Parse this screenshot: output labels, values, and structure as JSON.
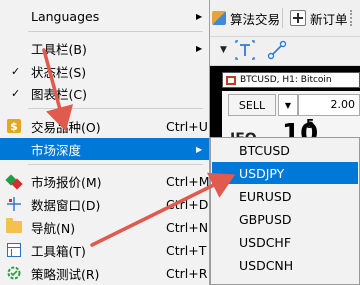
{
  "toolbar": {
    "algo_label": "算法交易",
    "new_order_label": "新订单"
  },
  "chart": {
    "title": "BTCUSD, H1: Bitcoin",
    "sell_label": "SELL",
    "lot_value": "2.00",
    "price_big": "10",
    "price_sup": "5",
    "price_partial": "IEO"
  },
  "menu": {
    "items": [
      {
        "label": "Languages",
        "shortcut": "",
        "has_submenu": true,
        "icon": "none"
      },
      {
        "label": "工具栏(B)",
        "shortcut": "",
        "has_submenu": true,
        "icon": "none"
      },
      {
        "label": "状态栏(S)",
        "shortcut": "",
        "has_submenu": false,
        "icon": "check-icon"
      },
      {
        "label": "图表栏(C)",
        "shortcut": "",
        "has_submenu": false,
        "icon": "check-icon"
      },
      {
        "label": "交易品种(O)",
        "shortcut": "Ctrl+U",
        "has_submenu": false,
        "icon": "dollar-icon"
      },
      {
        "label": "市场深度",
        "shortcut": "",
        "has_submenu": true,
        "icon": "none",
        "highlighted": true
      },
      {
        "label": "市场报价(M)",
        "shortcut": "Ctrl+M",
        "has_submenu": false,
        "icon": "market-watch-icon"
      },
      {
        "label": "数据窗口(D)",
        "shortcut": "Ctrl+D",
        "has_submenu": false,
        "icon": "crosshair-icon"
      },
      {
        "label": "导航(N)",
        "shortcut": "Ctrl+N",
        "has_submenu": false,
        "icon": "folder-icon"
      },
      {
        "label": "工具箱(T)",
        "shortcut": "Ctrl+T",
        "has_submenu": false,
        "icon": "toolbox-icon"
      },
      {
        "label": "策略测试(R)",
        "shortcut": "Ctrl+R",
        "has_submenu": false,
        "icon": "strategy-tester-icon"
      }
    ],
    "check_glyph": "✓",
    "submenu_arrow": "▶"
  },
  "submenu": {
    "items": [
      "BTCUSD",
      "USDJPY",
      "EURUSD",
      "GBPUSD",
      "USDCHF",
      "USDCNH"
    ],
    "highlighted": "USDJPY"
  },
  "colors": {
    "highlight": "#0078d7",
    "annotation_arrow": "#e05a4e"
  }
}
